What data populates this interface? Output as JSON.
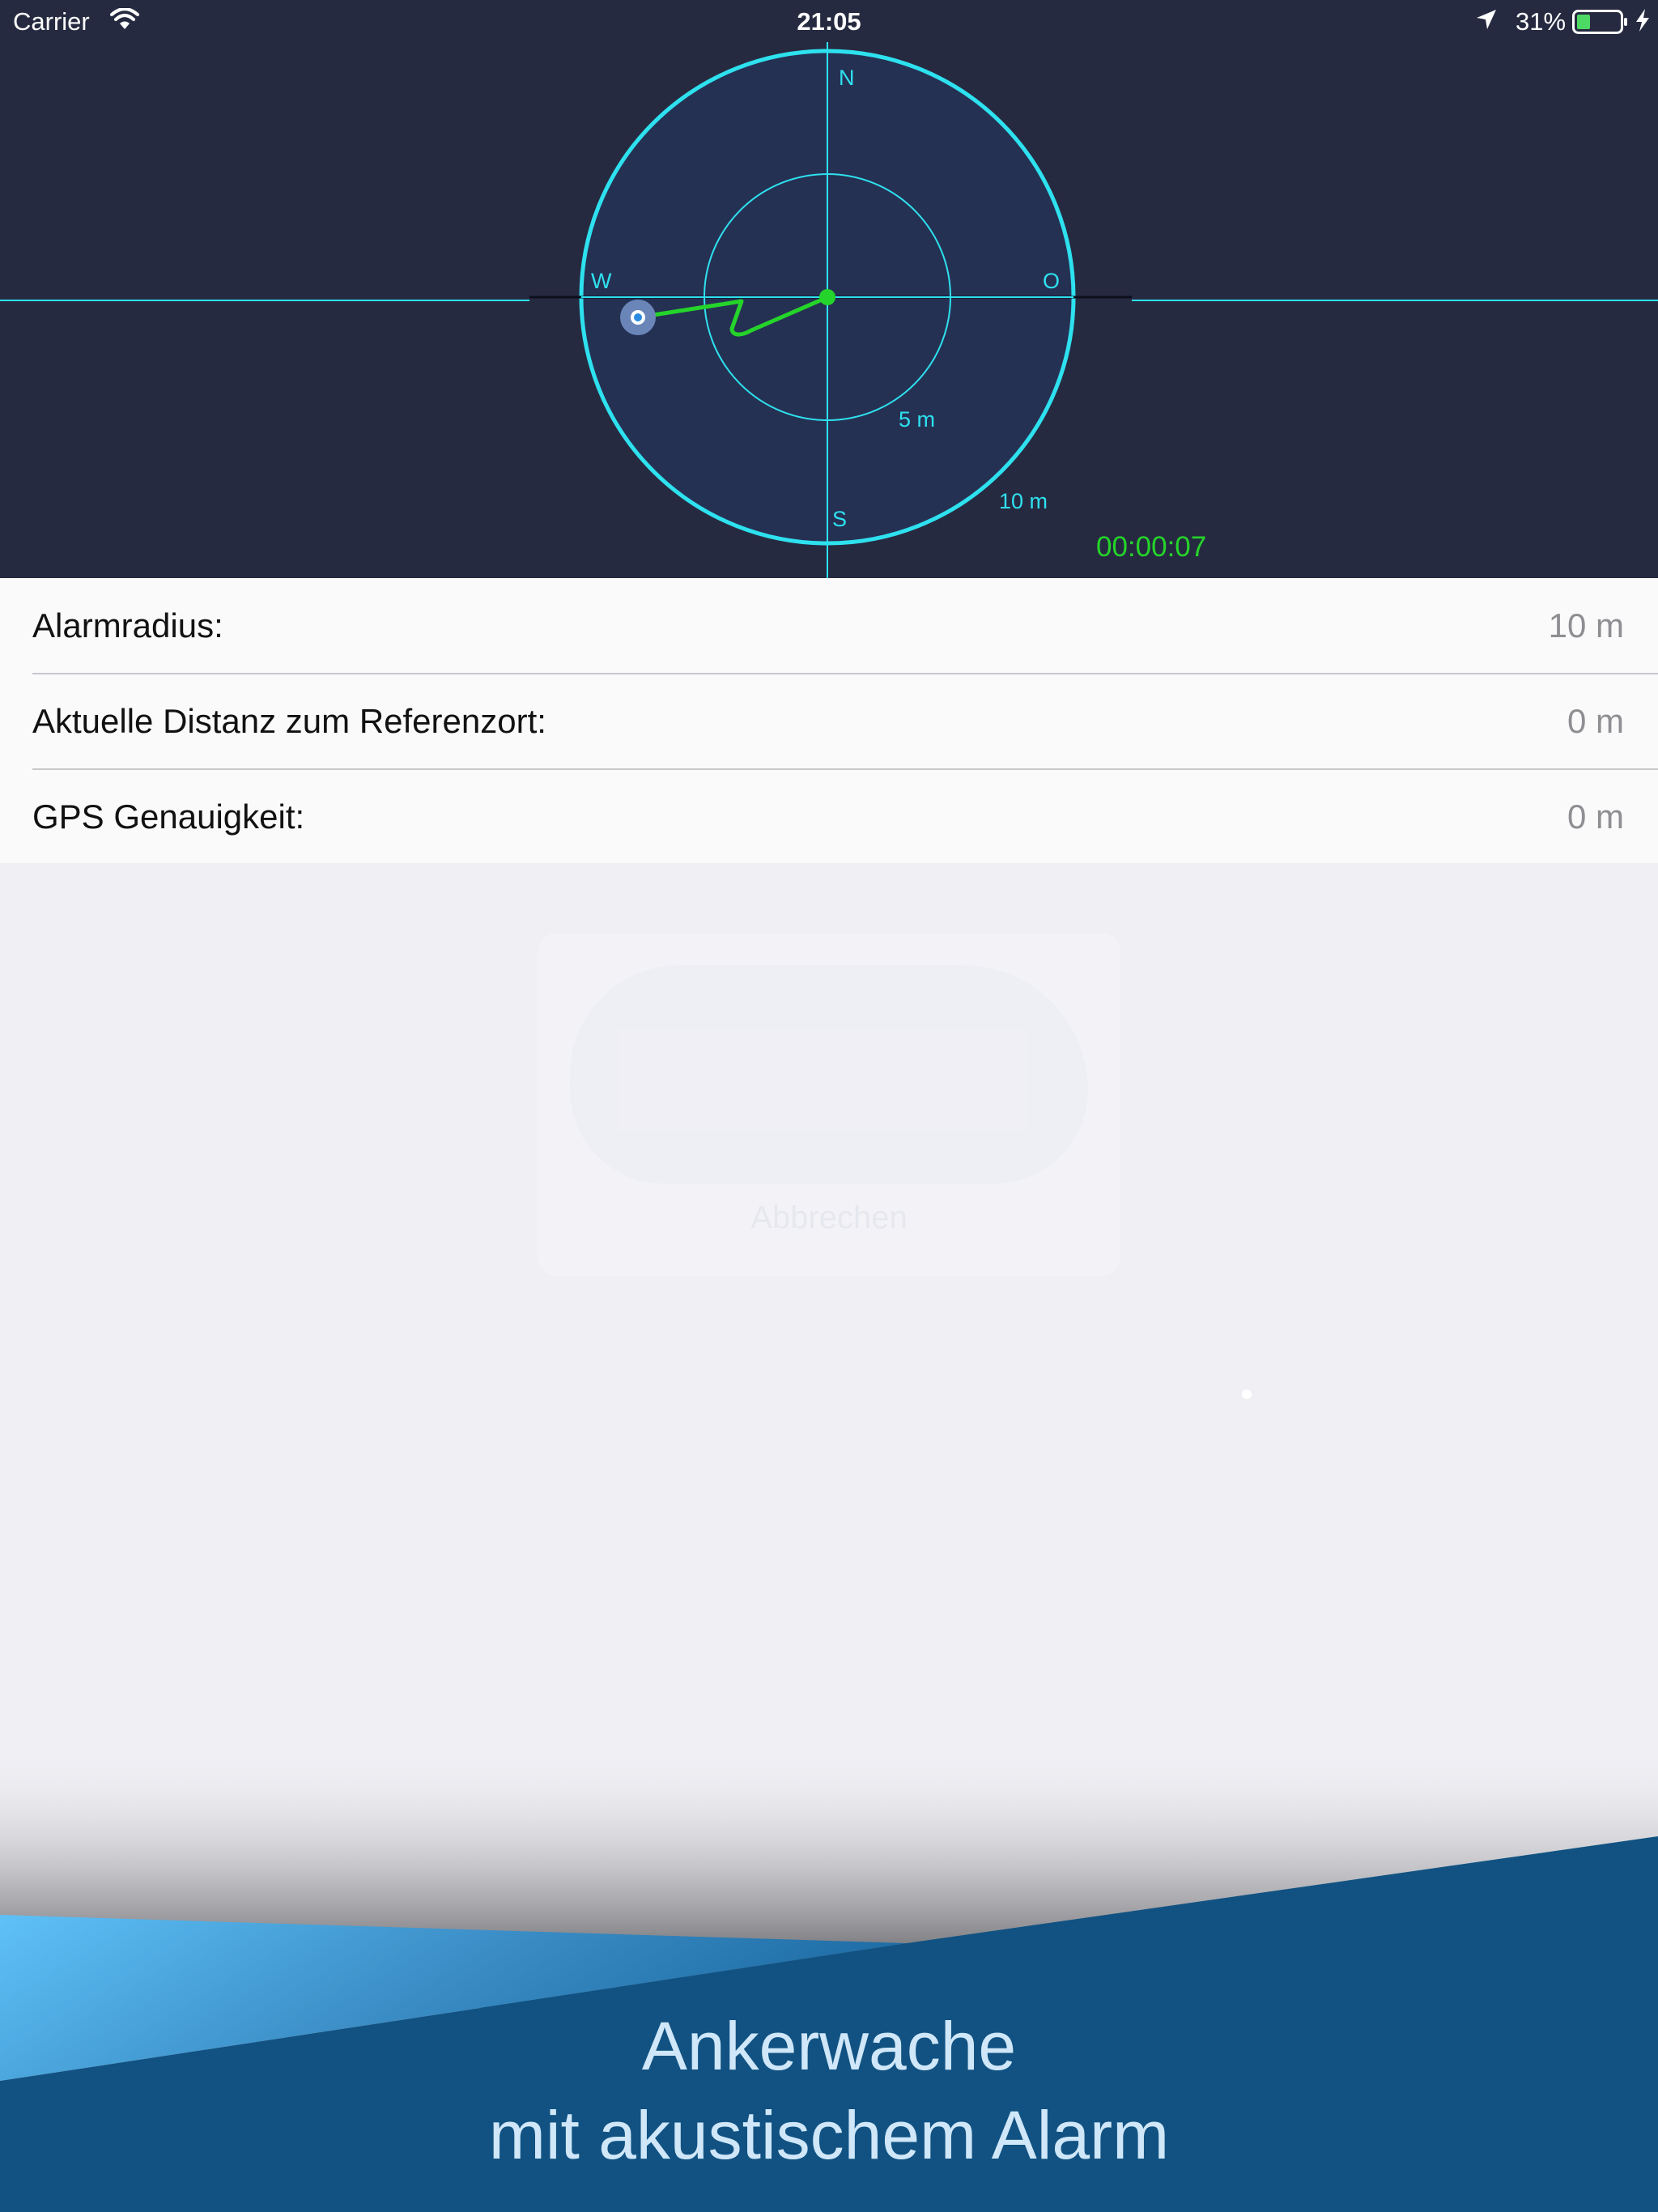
{
  "status_bar": {
    "carrier": "Carrier",
    "time": "21:05",
    "battery_percent": "31%",
    "wifi_icon": "wifi-icon",
    "location_icon": "location-arrow-icon",
    "battery_icon": "battery-icon",
    "charging_icon": "charging-bolt-icon",
    "battery_level": 0.31
  },
  "radar": {
    "north": "N",
    "south": "S",
    "west": "W",
    "east": "O",
    "inner_ring_label": "5 m",
    "outer_ring_label": "10 m",
    "timer": "00:00:07",
    "colors": {
      "ring": "#2ee1ef",
      "track": "#25d42a",
      "background": "#262a40",
      "disc": "#253153"
    }
  },
  "info_list": [
    {
      "label": "Alarmradius:",
      "value": "10 m"
    },
    {
      "label": "Aktuelle Distanz zum Referenzort:",
      "value": "0 m"
    },
    {
      "label": "GPS Genauigkeit:",
      "value": "0 m"
    }
  ],
  "ghost_dialog": {
    "cancel_label": "Abbrechen"
  },
  "banner": {
    "line1": "Ankerwache",
    "line2": "mit akustischem Alarm",
    "colors": {
      "dark": "#115282",
      "light": "#5ec1f7"
    }
  }
}
